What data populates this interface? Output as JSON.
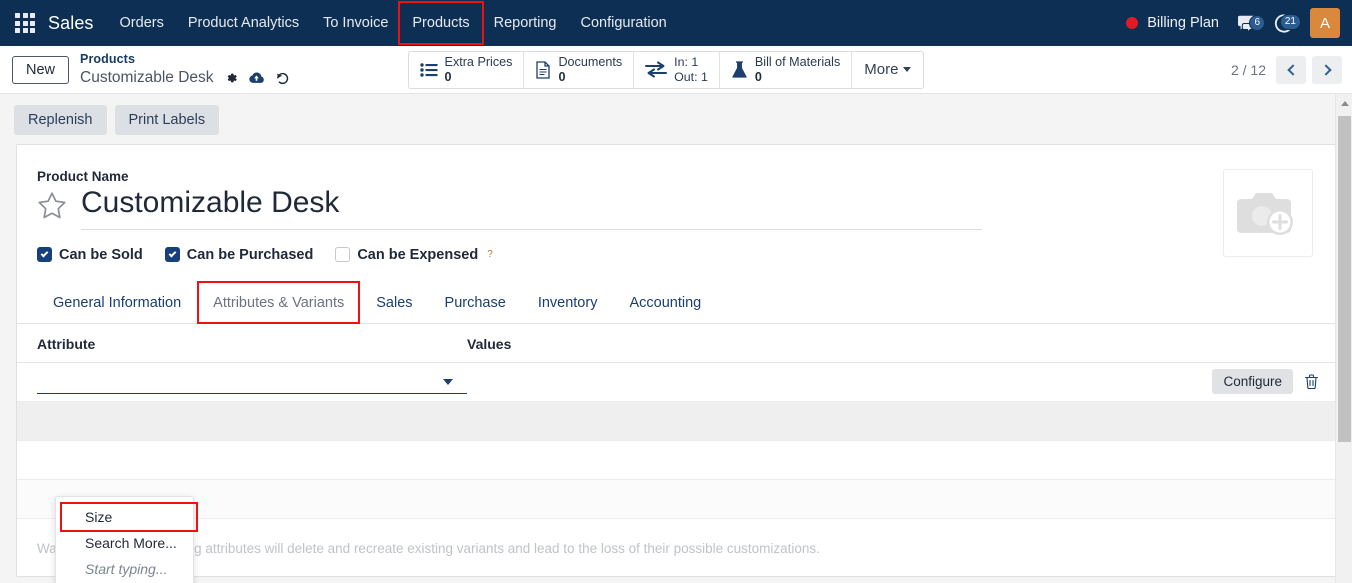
{
  "navbar": {
    "apps_icon": "grid-apps-icon",
    "brand": "Sales",
    "menu_items": [
      {
        "label": "Orders",
        "highlighted": false
      },
      {
        "label": "Product Analytics",
        "highlighted": false
      },
      {
        "label": "To Invoice",
        "highlighted": false
      },
      {
        "label": "Products",
        "highlighted": true
      },
      {
        "label": "Reporting",
        "highlighted": false
      },
      {
        "label": "Configuration",
        "highlighted": false
      }
    ],
    "status_dot_color": "#e01b24",
    "billing_plan": "Billing Plan",
    "messages_icon": "chat-bubble-icon",
    "messages_count": "6",
    "activities_icon": "clock-activity-icon",
    "activities_count": "21",
    "avatar_initial": "A",
    "avatar_color": "#d9883c"
  },
  "control_panel": {
    "new_label": "New",
    "breadcrumb_parent": "Products",
    "breadcrumb_record": "Customizable Desk",
    "settings_icon": "gear-icon",
    "save_icon": "cloud-upload-icon",
    "discard_icon": "undo-discard-icon",
    "stat_buttons": [
      {
        "icon": "list-pricing-icon",
        "label": "Extra Prices",
        "value": "0"
      },
      {
        "icon": "document-icon",
        "label": "Documents",
        "value": "0"
      },
      {
        "icon": "in-out-arrows-icon",
        "label_in": "In: 1",
        "label_out": "Out: 1"
      },
      {
        "icon": "flask-bom-icon",
        "label": "Bill of Materials",
        "value": "0"
      }
    ],
    "more_label": "More",
    "pager_text": "2 / 12",
    "prev_icon": "chevron-left-icon",
    "next_icon": "chevron-right-icon"
  },
  "action_bar": {
    "buttons": [
      {
        "label": "Replenish"
      },
      {
        "label": "Print Labels"
      }
    ]
  },
  "form": {
    "product_name_label": "Product Name",
    "product_name_value": "Customizable Desk",
    "favorite_icon": "star-outline-icon",
    "image_placeholder_icon": "camera-add-photo-icon",
    "checkboxes": [
      {
        "label": "Can be Sold",
        "checked": true,
        "help": ""
      },
      {
        "label": "Can be Purchased",
        "checked": true,
        "help": ""
      },
      {
        "label": "Can be Expensed",
        "checked": false,
        "help": "?"
      }
    ],
    "tabs": [
      {
        "label": "General Information",
        "active": false,
        "highlighted": false
      },
      {
        "label": "Attributes & Variants",
        "active": true,
        "highlighted": true
      },
      {
        "label": "Sales",
        "active": false,
        "highlighted": false
      },
      {
        "label": "Purchase",
        "active": false,
        "highlighted": false
      },
      {
        "label": "Inventory",
        "active": false,
        "highlighted": false
      },
      {
        "label": "Accounting",
        "active": false,
        "highlighted": false
      }
    ],
    "attributes_list": {
      "columns": {
        "attribute": "Attribute",
        "values": "Values"
      },
      "editing_row": {
        "attribute_value": "",
        "attribute_placeholder": "",
        "configure_label": "Configure",
        "delete_icon": "trash-icon",
        "dropdown_icon": "dropdown-caret-icon"
      }
    },
    "autocomplete": {
      "items": [
        {
          "label": "Size",
          "highlighted": true,
          "italic": false
        },
        {
          "label": "Search More...",
          "highlighted": false,
          "italic": false
        },
        {
          "label": "Start typing...",
          "highlighted": false,
          "italic": true
        }
      ]
    },
    "warning": "Warning: adding or deleting attributes will delete and recreate existing variants and lead to the loss of their possible customizations."
  },
  "scrollbar": {
    "up_icon": "scroll-up-arrow-icon",
    "thumb": "scroll-thumb"
  },
  "colors": {
    "navbar_bg": "#0d2f54",
    "highlight_box": "#ef1010",
    "accent": "#1b3f6e"
  }
}
